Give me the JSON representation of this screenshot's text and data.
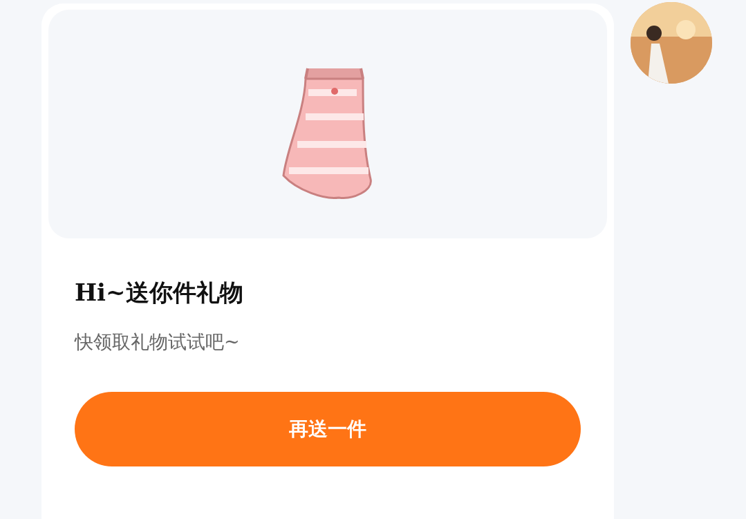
{
  "gift_card": {
    "title": "Hi~送你件礼物",
    "subtitle": "快领取礼物试试吧~",
    "button": "再送一件"
  }
}
